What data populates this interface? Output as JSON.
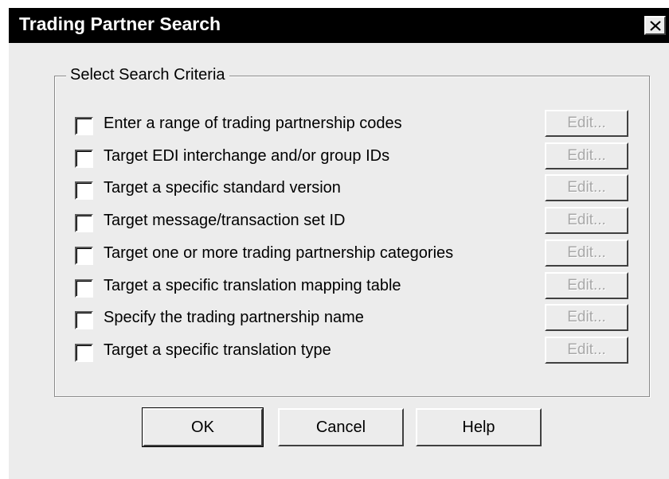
{
  "window": {
    "title": "Trading Partner Search",
    "close_icon": "close-icon"
  },
  "group": {
    "label": "Select Search Criteria"
  },
  "criteria": [
    {
      "label": "Enter a range of trading partnership codes",
      "checked": false,
      "edit_label": "Edit...",
      "edit_enabled": false
    },
    {
      "label": "Target EDI interchange and/or group IDs",
      "checked": false,
      "edit_label": "Edit...",
      "edit_enabled": false
    },
    {
      "label": "Target a specific standard version",
      "checked": false,
      "edit_label": "Edit...",
      "edit_enabled": false
    },
    {
      "label": "Target message/transaction set ID",
      "checked": false,
      "edit_label": "Edit...",
      "edit_enabled": false
    },
    {
      "label": "Target one or more trading partnership categories",
      "checked": false,
      "edit_label": "Edit...",
      "edit_enabled": false
    },
    {
      "label": "Target a specific translation mapping table",
      "checked": false,
      "edit_label": "Edit...",
      "edit_enabled": false
    },
    {
      "label": "Specify the trading partnership name",
      "checked": false,
      "edit_label": "Edit...",
      "edit_enabled": false
    },
    {
      "label": "Target a specific translation type",
      "checked": false,
      "edit_label": "Edit...",
      "edit_enabled": false
    }
  ],
  "buttons": {
    "ok": "OK",
    "cancel": "Cancel",
    "help": "Help"
  },
  "colors": {
    "titlebar": "#000000",
    "dialog_face": "#ececec",
    "disabled_text": "#a8a8a8"
  }
}
